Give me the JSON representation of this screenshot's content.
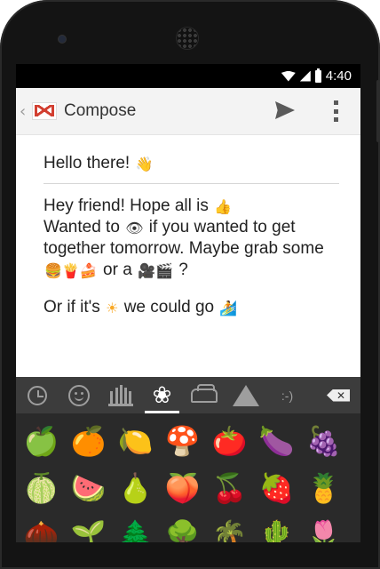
{
  "status_bar": {
    "time": "4:40",
    "icons": [
      "wifi-icon",
      "signal-icon",
      "battery-icon"
    ]
  },
  "action_bar": {
    "up_caret": "‹",
    "title": "Compose",
    "icons": [
      "gmail-icon",
      "send-icon",
      "overflow-menu-icon"
    ]
  },
  "compose": {
    "subject_text": "Hello there!",
    "subject_emoji": "👋",
    "body": {
      "l1_text": "Hey friend! Hope all is ",
      "l1_emoji": "👍",
      "l2_a": "Wanted to ",
      "l2_emoji": "👁",
      "l2_b": " if you wanted to get",
      "l3": "together tomorrow. Maybe grab some",
      "l4_emoji_a": "🍔🍟🍰",
      "l4_mid": " or a ",
      "l4_emoji_b": "🎥🎬",
      "l4_end": " ?",
      "l5_a": "Or if it's ",
      "l5_emoji": "☀",
      "l5_b": " we could go ",
      "l5_emoji_end": "🏄"
    }
  },
  "keyboard": {
    "tabs": [
      {
        "icon": "clock-icon",
        "active": false
      },
      {
        "icon": "smiley-icon",
        "active": false
      },
      {
        "icon": "crown-icon",
        "active": false
      },
      {
        "icon": "flower-icon",
        "glyph": "❀",
        "active": true
      },
      {
        "icon": "car-icon",
        "active": false
      },
      {
        "icon": "triangle-icon",
        "active": false
      },
      {
        "label": ":-)",
        "active": false
      }
    ],
    "backspace_glyph": "✕",
    "emoji_rows": [
      [
        {
          "glyph": "🍏",
          "color": "#7cb342"
        },
        {
          "glyph": "🍊",
          "color": "#fb8c00"
        },
        {
          "glyph": "🍋",
          "color": "#fdd835"
        },
        {
          "glyph": "🍄",
          "color": "#e57373"
        },
        {
          "glyph": "🍅",
          "color": "#e53935"
        },
        {
          "glyph": "🍆",
          "color": "#8e24aa"
        },
        {
          "glyph": "🍇",
          "color": "#c2185b"
        }
      ],
      [
        {
          "glyph": "🍈",
          "color": "#9ccc65"
        },
        {
          "glyph": "🍉",
          "color": "#e53935"
        },
        {
          "glyph": "🍐",
          "color": "#c0ca33"
        },
        {
          "glyph": "🍑",
          "color": "#ff8a65"
        },
        {
          "glyph": "🍒",
          "color": "#d32f2f"
        },
        {
          "glyph": "🍓",
          "color": "#e53935"
        },
        {
          "glyph": "🍍",
          "color": "#fbc02d"
        }
      ],
      [
        {
          "glyph": "🌰",
          "color": "#6d4c41"
        },
        {
          "glyph": "🌱",
          "color": "#43a047"
        },
        {
          "glyph": "🌲",
          "color": "#2e7d32"
        },
        {
          "glyph": "🌳",
          "color": "#388e3c"
        },
        {
          "glyph": "🌴",
          "color": "#558b2f"
        },
        {
          "glyph": "🌵",
          "color": "#689f38"
        },
        {
          "glyph": "🌷",
          "color": "#e64a19"
        }
      ]
    ]
  }
}
